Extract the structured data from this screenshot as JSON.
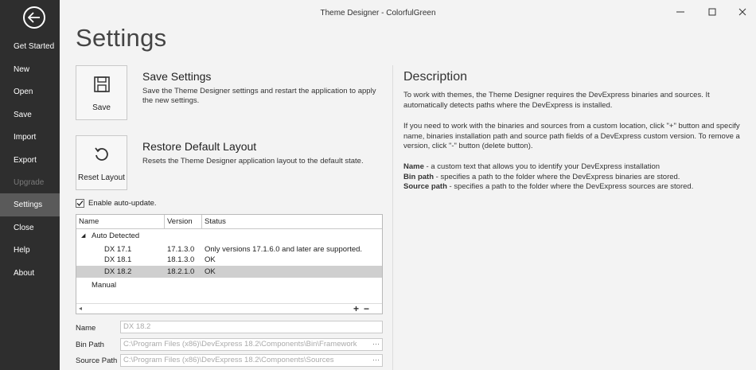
{
  "window": {
    "title": "Theme Designer - ColorfulGreen"
  },
  "sidebar": {
    "items": [
      {
        "label": "Get Started"
      },
      {
        "label": "New"
      },
      {
        "label": "Open"
      },
      {
        "label": "Save"
      },
      {
        "label": "Import"
      },
      {
        "label": "Export"
      },
      {
        "label": "Upgrade",
        "disabled": true
      },
      {
        "label": "Settings",
        "active": true
      },
      {
        "label": "Close"
      },
      {
        "label": "Help"
      },
      {
        "label": "About"
      }
    ]
  },
  "main": {
    "page_title": "Settings",
    "save_settings": {
      "button_label": "Save",
      "title": "Save Settings",
      "desc": "Save the Theme Designer settings and restart the application to apply the new settings."
    },
    "restore_layout": {
      "button_label": "Reset Layout",
      "title": "Restore Default Layout",
      "desc": "Resets the Theme Designer application layout to the default state."
    },
    "auto_update": {
      "label": "Enable auto-update.",
      "checked": true
    },
    "grid": {
      "columns": [
        "Name",
        "Version",
        "Status"
      ],
      "group_auto": "Auto Detected",
      "rows": [
        {
          "name": "DX 17.1",
          "version": "17.1.3.0",
          "status": "Only versions 17.1.6.0 and later are supported."
        },
        {
          "name": "DX 18.1",
          "version": "18.1.3.0",
          "status": "OK"
        },
        {
          "name": "DX 18.2",
          "version": "18.2.1.0",
          "status": "OK",
          "selected": true
        }
      ],
      "group_manual": "Manual",
      "add_symbol": "+",
      "remove_symbol": "−"
    },
    "fields": {
      "name_label": "Name",
      "name_value": "DX 18.2",
      "bin_label": "Bin Path",
      "bin_value": "C:\\Program Files (x86)\\DevExpress 18.2\\Components\\Bin\\Framework",
      "source_label": "Source Path",
      "source_value": "C:\\Program Files (x86)\\DevExpress 18.2\\Components\\Sources",
      "browse": "···"
    }
  },
  "description": {
    "title": "Description",
    "para1": "To work with themes, the Theme Designer requires the DevExpress binaries and sources. It automatically detects paths where the DevExpress is installed.",
    "para2": "If you need to work with the binaries and sources from a custom location, click \"+\" button and specify name, binaries installation path and source path fields of a DevExpress custom version. To remove a version, click \"-\" button (delete button).",
    "name_term": "Name",
    "name_text": " - a custom text that allows you to identify your DevExpress installation",
    "bin_term": "Bin path",
    "bin_text": " - specifies a path to the folder where the DevExpress binaries are stored.",
    "source_term": "Source path",
    "source_text": " - specifies a path to the folder where the DevExpress sources are stored."
  },
  "colors": {
    "sidebar_bg": "#2e2e2e",
    "sidebar_active": "#5a5a5a",
    "content_bg": "#f3f3f3",
    "selected_row": "#cfcfcf"
  }
}
